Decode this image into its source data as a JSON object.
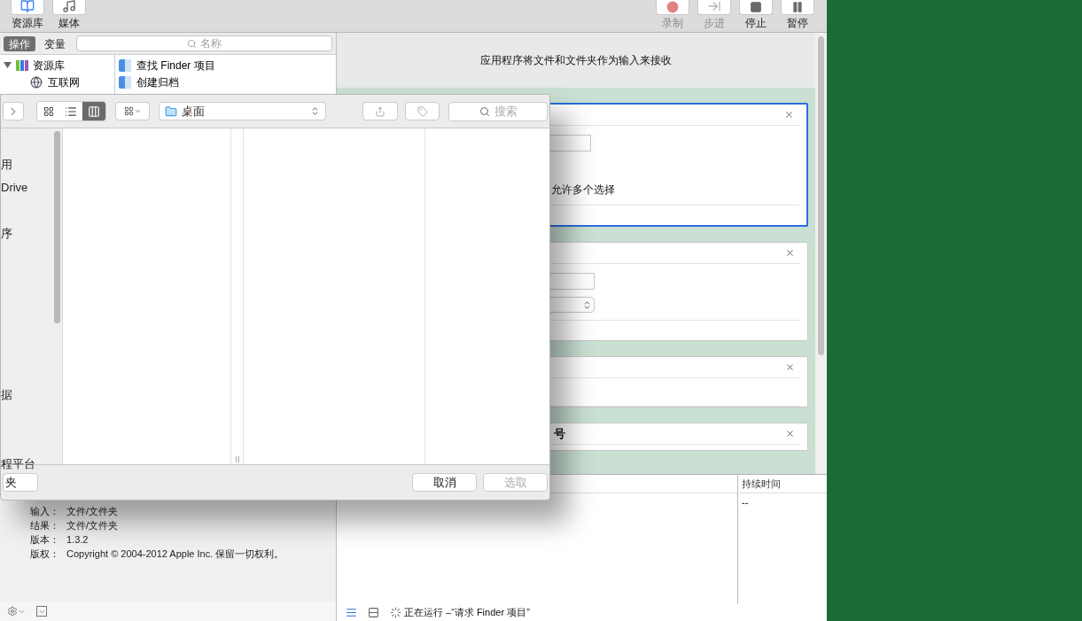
{
  "toolbar": {
    "left": [
      {
        "label": "资源库",
        "kind": "library"
      },
      {
        "label": "媒体",
        "kind": "media"
      }
    ],
    "right": [
      {
        "label": "录制",
        "kind": "record",
        "disabled": true
      },
      {
        "label": "步进",
        "kind": "step",
        "disabled": true
      },
      {
        "label": "停止",
        "kind": "stop",
        "disabled": false
      },
      {
        "label": "暂停",
        "kind": "pause",
        "disabled": false
      }
    ]
  },
  "library": {
    "tabs": [
      {
        "label": "操作",
        "selected": true
      },
      {
        "label": "变量",
        "selected": false
      }
    ],
    "search": {
      "placeholder": "名称"
    },
    "categories": [
      {
        "label": "资源库",
        "expanded": true,
        "children": [
          {
            "label": "互联网"
          }
        ]
      }
    ],
    "actions": [
      {
        "label": "查找 Finder 项目"
      },
      {
        "label": "创建归档"
      }
    ]
  },
  "description": {
    "rows": [
      {
        "key": "输入：",
        "value": "文件/文件夹"
      },
      {
        "key": "结果：",
        "value": "文件/文件夹"
      },
      {
        "key": "版本：",
        "value": "1.3.2"
      },
      {
        "key": "版权：",
        "value": "Copyright © 2004-2012 Apple Inc.  保留一切权利。"
      }
    ]
  },
  "workflow": {
    "header": "应用程序将文件和文件夹作为输入来接收",
    "cards": [
      {
        "selected": true,
        "kind": "field-checkbox",
        "checkbox_label": "允许多个选择"
      },
      {
        "selected": false,
        "kind": "field-select"
      },
      {
        "selected": false,
        "kind": "empty"
      },
      {
        "selected": false,
        "kind": "titled",
        "title": "号"
      }
    ]
  },
  "log": {
    "columns": [
      "持续时间"
    ],
    "rows": [
      {
        "duration": "--"
      }
    ]
  },
  "status": {
    "text": "正在运行 –“请求 Finder 项目”"
  },
  "dialog": {
    "views": [
      {
        "kind": "icons",
        "selected": false
      },
      {
        "kind": "list",
        "selected": false
      },
      {
        "kind": "columns",
        "selected": true
      }
    ],
    "path": "桌面",
    "search": {
      "placeholder": "搜索"
    },
    "sidebar": [
      "用",
      "Drive",
      "序",
      "据",
      "程平台"
    ],
    "buttons": [
      {
        "label": "夹",
        "disabled": false
      },
      {
        "label": "取消",
        "disabled": false
      },
      {
        "label": "选取",
        "disabled": true
      }
    ]
  }
}
